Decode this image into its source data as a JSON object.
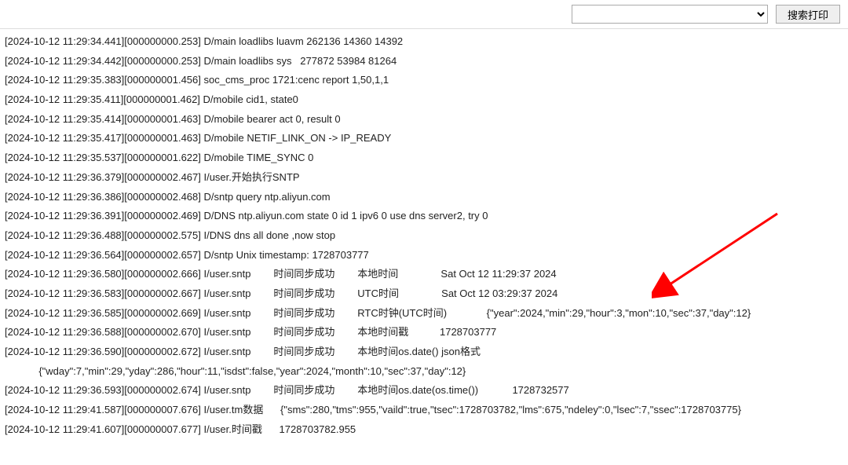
{
  "toolbar": {
    "dropdown_value": "",
    "search_button": "搜索打印"
  },
  "arrow": {
    "color": "#ff0000"
  },
  "log": [
    "[2024-10-12 11:29:34.441][000000000.253] D/main loadlibs luavm 262136 14360 14392",
    "[2024-10-12 11:29:34.442][000000000.253] D/main loadlibs sys   277872 53984 81264",
    "[2024-10-12 11:29:35.383][000000001.456] soc_cms_proc 1721:cenc report 1,50,1,1",
    "[2024-10-12 11:29:35.411][000000001.462] D/mobile cid1, state0",
    "[2024-10-12 11:29:35.414][000000001.463] D/mobile bearer act 0, result 0",
    "[2024-10-12 11:29:35.417][000000001.463] D/mobile NETIF_LINK_ON -> IP_READY",
    "[2024-10-12 11:29:35.537][000000001.622] D/mobile TIME_SYNC 0",
    "[2024-10-12 11:29:36.379][000000002.467] I/user.开始执行SNTP",
    "[2024-10-12 11:29:36.386][000000002.468] D/sntp query ntp.aliyun.com",
    "[2024-10-12 11:29:36.391][000000002.469] D/DNS ntp.aliyun.com state 0 id 1 ipv6 0 use dns server2, try 0",
    "[2024-10-12 11:29:36.488][000000002.575] I/DNS dns all done ,now stop",
    "[2024-10-12 11:29:36.564][000000002.657] D/sntp Unix timestamp: 1728703777",
    "[2024-10-12 11:29:36.580][000000002.666] I/user.sntp        时间同步成功        本地时间               Sat Oct 12 11:29:37 2024",
    "[2024-10-12 11:29:36.583][000000002.667] I/user.sntp        时间同步成功        UTC时间               Sat Oct 12 03:29:37 2024",
    "[2024-10-12 11:29:36.585][000000002.669] I/user.sntp        时间同步成功        RTC时钟(UTC时间)              {\"year\":2024,\"min\":29,\"hour\":3,\"mon\":10,\"sec\":37,\"day\":12}",
    "[2024-10-12 11:29:36.588][000000002.670] I/user.sntp        时间同步成功        本地时间戳           1728703777",
    "[2024-10-12 11:29:36.590][000000002.672] I/user.sntp        时间同步成功        本地时间os.date() json格式",
    "            {\"wday\":7,\"min\":29,\"yday\":286,\"hour\":11,\"isdst\":false,\"year\":2024,\"month\":10,\"sec\":37,\"day\":12}",
    "[2024-10-12 11:29:36.593][000000002.674] I/user.sntp        时间同步成功        本地时间os.date(os.time())            1728732577",
    "[2024-10-12 11:29:41.587][000000007.676] I/user.tm数据      {\"sms\":280,\"tms\":955,\"vaild\":true,\"tsec\":1728703782,\"lms\":675,\"ndeley\":0,\"lsec\":7,\"ssec\":1728703775}",
    "[2024-10-12 11:29:41.607][000000007.677] I/user.时间戳      1728703782.955"
  ]
}
